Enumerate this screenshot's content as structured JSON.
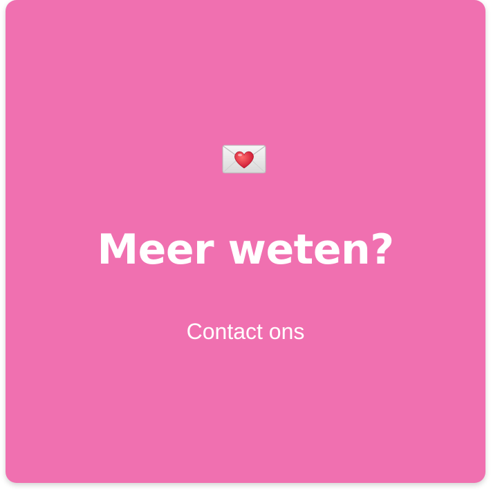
{
  "card": {
    "background_color": "#f070b0",
    "icon": "love-letter-icon",
    "title": "Meer weten?",
    "link_label": "Contact ons"
  }
}
